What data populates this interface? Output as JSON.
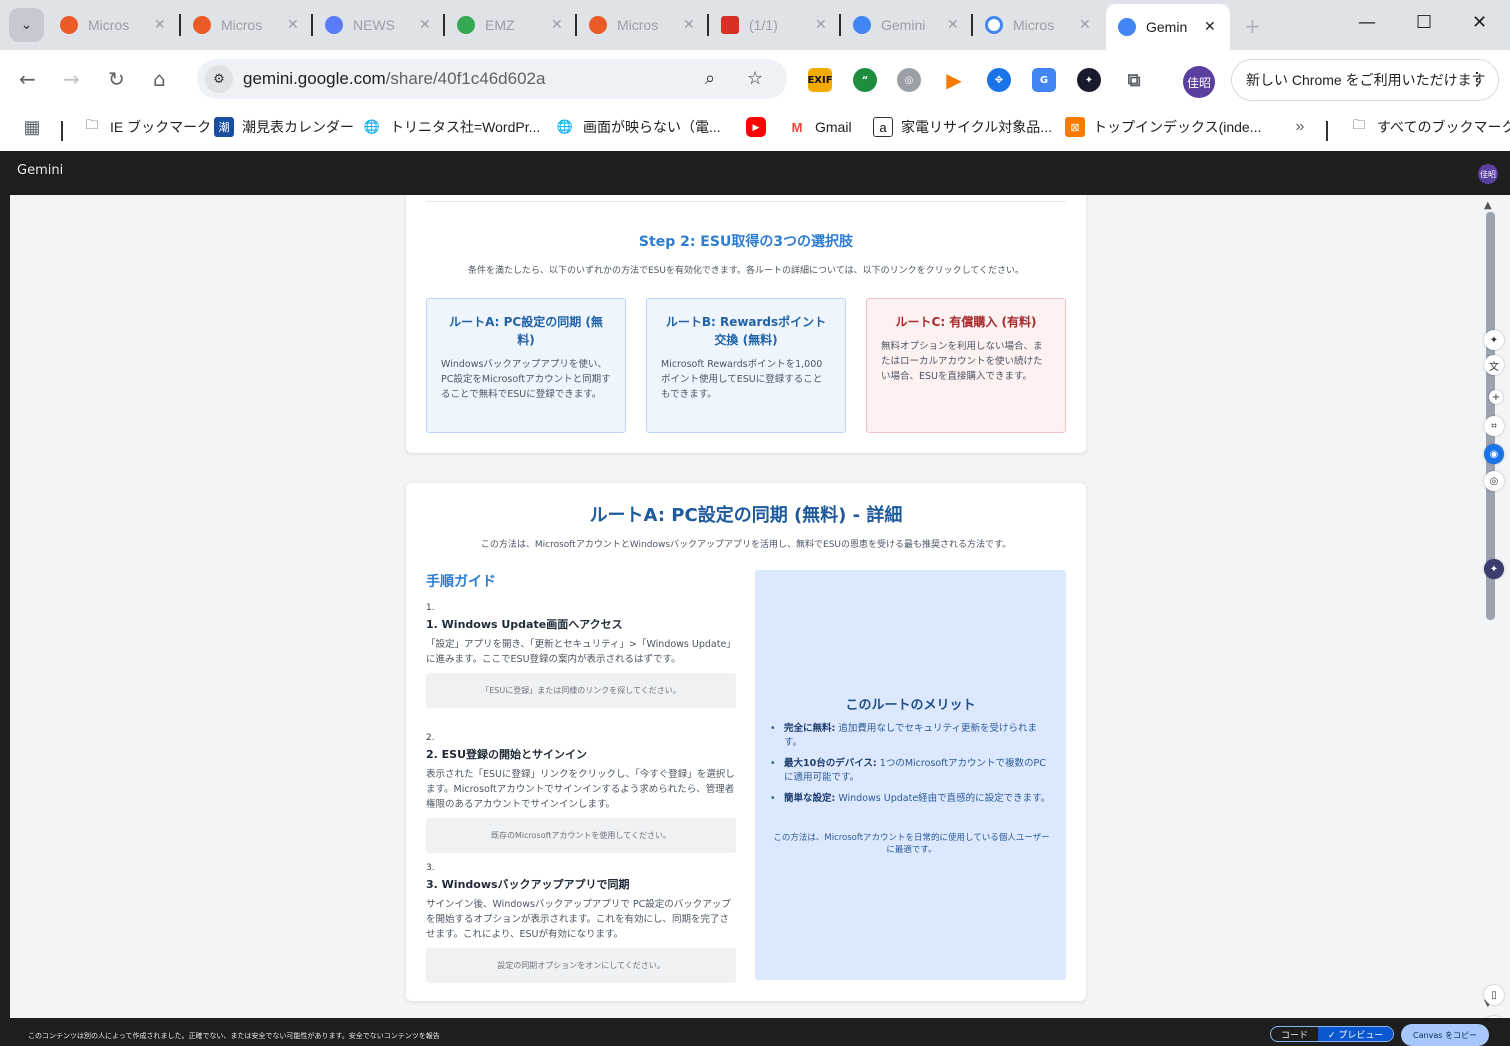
{
  "tabs": [
    {
      "title": "Micros",
      "color": "#ea5b28"
    },
    {
      "title": "Micros",
      "color": "#ea5b28"
    },
    {
      "title": "NEWS",
      "color": "#5b7cfa"
    },
    {
      "title": "EMZ",
      "color": "#34a853"
    },
    {
      "title": "Micros",
      "color": "#ea5b28"
    },
    {
      "title": "(1/1)",
      "color": "#d93025"
    },
    {
      "title": "Gemini",
      "color": "#4285f4"
    },
    {
      "title": "Micros",
      "color": "#4285f4"
    },
    {
      "title": "Gemin",
      "color": "#4285f4",
      "active": true
    }
  ],
  "address": {
    "host": "gemini.google.com",
    "path": "/share/40f1c46d602a"
  },
  "profile_initials": "佳昭",
  "chrome_notice": "新しい Chrome をご利用いただけます",
  "bookmarks": [
    {
      "label": "IE ブックマーク",
      "icon": "folder-icon"
    },
    {
      "label": "潮見表カレンダー",
      "icon": "tide-icon"
    },
    {
      "label": "トリニタス社=WordPr...",
      "icon": "globe-icon"
    },
    {
      "label": "画面が映らない（電...",
      "icon": "globe-icon"
    },
    {
      "label": "",
      "icon": "youtube-icon"
    },
    {
      "label": "Gmail",
      "icon": "gmail-icon"
    },
    {
      "label": "家電リサイクル対象品...",
      "icon": "amazon-icon"
    },
    {
      "label": "トップインデックス(inde...",
      "icon": "index-icon"
    },
    {
      "label": "すべてのブックマーク",
      "icon": "folder-icon"
    }
  ],
  "app": {
    "title": "Gemini"
  },
  "step2": {
    "title": "Step 2: ESU取得の3つの選択肢",
    "desc": "条件を満たしたら、以下のいずれかの方法でESUを有効化できます。各ルートの詳細については、以下のリンクをクリックしてください。",
    "routes": [
      {
        "title": "ルートA: PC設定の同期 (無料)",
        "body": "Windowsバックアップアプリを使い、PC設定をMicrosoftアカウントと同期することで無料でESUに登録できます。"
      },
      {
        "title": "ルートB: Rewardsポイント交換 (無料)",
        "body": "Microsoft Rewardsポイントを1,000ポイント使用してESUに登録することもできます。"
      },
      {
        "title": "ルートC: 有償購入 (有料)",
        "body": "無料オプションを利用しない場合、またはローカルアカウントを使い続けたい場合、ESUを直接購入できます。"
      }
    ]
  },
  "routeA": {
    "title": "ルートA: PC設定の同期 (無料) - 詳細",
    "desc": "この方法は、MicrosoftアカウントとWindowsバックアップアプリを活用し、無料でESUの恩恵を受ける最も推奨される方法です。",
    "guide_title": "手順ガイド",
    "steps": [
      {
        "num": "1.",
        "title": "1. Windows Update画面へアクセス",
        "body": "「設定」アプリを開き、「更新とセキュリティ」>「Windows Update」に進みます。ここでESU登録の案内が表示されるはずです。",
        "note": "「ESUに登録」または同様のリンクを探してください。"
      },
      {
        "num": "2.",
        "title": "2. ESU登録の開始とサインイン",
        "body": "表示された「ESUに登録」リンクをクリックし、「今すぐ登録」を選択します。Microsoftアカウントでサインインするよう求められたら、管理者権限のあるアカウントでサインインします。",
        "note": "既存のMicrosoftアカウントを使用してください。"
      },
      {
        "num": "3.",
        "title": "3. Windowsバックアップアプリで同期",
        "body": "サインイン後、Windowsバックアップアプリで PC設定のバックアップを開始するオプションが表示されます。これを有効にし、同期を完了させます。これにより、ESUが有効になります。",
        "note": "設定の同期オプションをオンにしてください。"
      }
    ],
    "merit": {
      "title": "このルートのメリット",
      "items": [
        {
          "bold": "完全に無料:",
          "text": " 追加費用なしでセキュリティ更新を受けられます。"
        },
        {
          "bold": "最大10台のデバイス:",
          "text": " 1つのMicrosoftアカウントで複数のPCに適用可能です。"
        },
        {
          "bold": "簡単な設定:",
          "text": " Windows Update経由で直感的に設定できます。"
        }
      ],
      "footer": "この方法は、Microsoftアカウントを日常的に使用している個人ユーザーに最適です。"
    }
  },
  "bottom": {
    "warning": "このコンテンツは別の人によって作成されました。正確でない、または安全でない可能性があります。安全でないコンテンツを報告",
    "code_label": "コード",
    "preview_label": "✓ プレビュー",
    "copy_label": "Canvas をコピー"
  },
  "colors": {
    "accent": "#2d7dd2",
    "route_c": "#a62b2b",
    "merit_bg": "#dbe8fd"
  }
}
